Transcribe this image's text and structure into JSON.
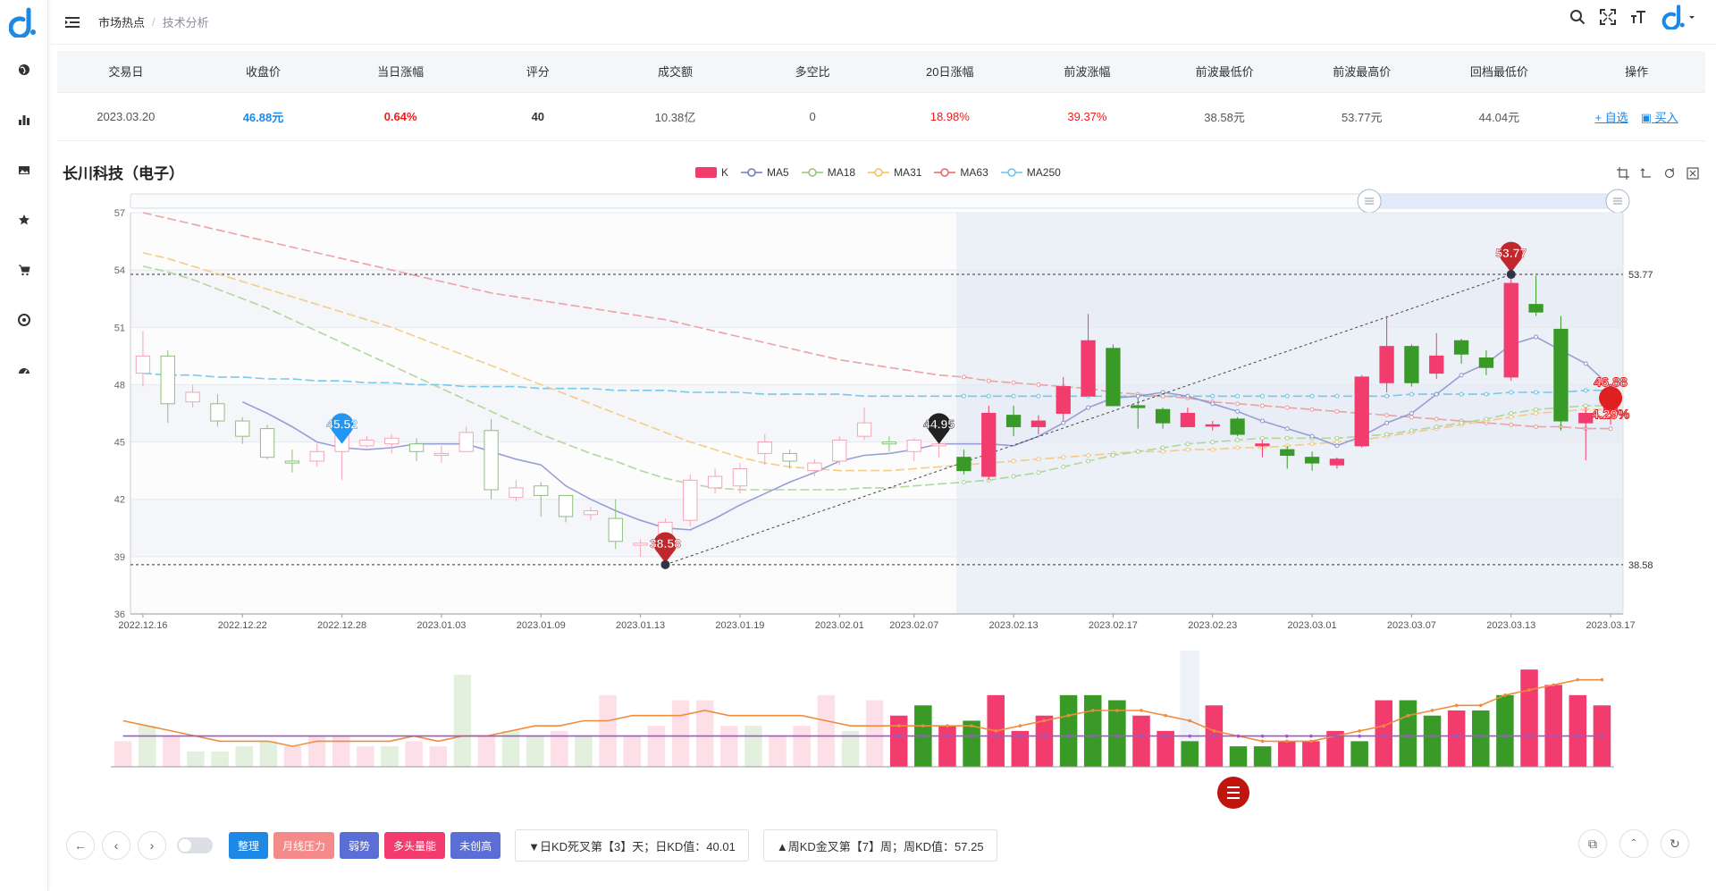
{
  "header": {
    "breadcrumb": [
      "市场热点",
      "技术分析"
    ],
    "logo": "d-logo",
    "tools": [
      "search-icon",
      "fullscreen-icon",
      "font-size-icon",
      "user-logo"
    ]
  },
  "sidebar": {
    "items": [
      {
        "icon": "globe-icon"
      },
      {
        "icon": "bar-chart-icon"
      },
      {
        "icon": "image-icon"
      },
      {
        "icon": "star-icon"
      },
      {
        "icon": "cart-icon"
      },
      {
        "icon": "target-icon"
      },
      {
        "icon": "dashboard-icon"
      }
    ]
  },
  "summary": {
    "headers": [
      "交易日",
      "收盘价",
      "当日涨幅",
      "评分",
      "成交额",
      "多空比",
      "20日涨幅",
      "前波涨幅",
      "前波最低价",
      "前波最高价",
      "回档最低价",
      "操作"
    ],
    "row": {
      "date": "2023.03.20",
      "close": "46.88元",
      "change": "0.64%",
      "score": "40",
      "turnover": "10.38亿",
      "ratio": "0",
      "change20": "18.98%",
      "prev_wave": "39.37%",
      "prev_low": "38.58元",
      "prev_high": "53.77元",
      "pullback_low": "44.04元",
      "op_add": "+ 自选",
      "op_buy": "买入"
    }
  },
  "stock_title": "长川科技（电子）",
  "legend": [
    {
      "name": "K",
      "color": "#f23c6e"
    },
    {
      "name": "MA5",
      "color": "#6f7bb8"
    },
    {
      "name": "MA18",
      "color": "#93c47d"
    },
    {
      "name": "MA31",
      "color": "#f3c25b"
    },
    {
      "name": "MA63",
      "color": "#e06666"
    },
    {
      "name": "MA250",
      "color": "#6bc3e6"
    }
  ],
  "chart_data": {
    "type": "candlestick",
    "y_ticks": [
      36,
      39,
      42,
      45,
      48,
      51,
      54,
      57
    ],
    "ylim": [
      36,
      57
    ],
    "x_tick_labels": [
      "2022.12.16",
      "2022.12.22",
      "2022.12.28",
      "2023.01.03",
      "2023.01.09",
      "2023.01.13",
      "2023.01.19",
      "2023.02.01",
      "2023.02.07",
      "2023.02.13",
      "2023.02.17",
      "2023.02.23",
      "2023.03.01",
      "2023.03.07",
      "2023.03.13",
      "2023.03.17"
    ],
    "ohlc": [
      [
        48.6,
        49.5,
        50.8,
        47.9
      ],
      [
        49.5,
        47.0,
        49.8,
        46.0
      ],
      [
        47.1,
        47.6,
        48.0,
        46.8
      ],
      [
        47.0,
        46.1,
        47.5,
        45.8
      ],
      [
        46.1,
        45.3,
        46.3,
        44.9
      ],
      [
        45.7,
        44.2,
        45.9,
        44.1
      ],
      [
        44.0,
        43.9,
        44.6,
        43.4
      ],
      [
        44.0,
        44.5,
        44.9,
        43.7
      ],
      [
        44.5,
        45.5,
        45.6,
        43.0
      ],
      [
        44.8,
        45.1,
        45.3,
        44.7
      ],
      [
        44.9,
        45.2,
        45.4,
        44.4
      ],
      [
        44.9,
        44.5,
        45.2,
        44.0
      ],
      [
        44.3,
        44.4,
        44.8,
        43.9
      ],
      [
        44.5,
        45.5,
        45.8,
        44.5
      ],
      [
        45.6,
        42.5,
        46.2,
        42.0
      ],
      [
        42.1,
        42.6,
        43.0,
        41.9
      ],
      [
        42.7,
        42.2,
        42.9,
        41.1
      ],
      [
        42.2,
        41.1,
        42.2,
        40.8
      ],
      [
        41.2,
        41.4,
        41.6,
        40.9
      ],
      [
        41.0,
        39.8,
        42.0,
        39.4
      ],
      [
        39.6,
        39.7,
        39.9,
        39.0
      ],
      [
        39.2,
        40.8,
        41.0,
        38.58
      ],
      [
        40.9,
        43.0,
        43.3,
        40.6
      ],
      [
        42.6,
        43.2,
        43.6,
        42.3
      ],
      [
        42.7,
        43.6,
        43.9,
        42.3
      ],
      [
        44.4,
        45.0,
        45.4,
        43.8
      ],
      [
        44.4,
        44.0,
        44.6,
        43.6
      ],
      [
        43.5,
        43.9,
        44.1,
        43.2
      ],
      [
        44.0,
        45.1,
        45.3,
        43.8
      ],
      [
        45.3,
        46.0,
        46.8,
        45.1
      ],
      [
        45.0,
        44.9,
        45.3,
        44.5
      ],
      [
        44.5,
        45.1,
        45.2,
        44.0
      ],
      [
        44.8,
        44.9,
        45.1,
        44.2
      ],
      [
        44.2,
        43.5,
        44.6,
        43.3
      ],
      [
        43.2,
        46.5,
        46.9,
        43.0
      ],
      [
        46.4,
        45.8,
        46.9,
        45.3
      ],
      [
        45.8,
        46.1,
        46.4,
        45.4
      ],
      [
        46.5,
        47.9,
        48.4,
        46.1
      ],
      [
        47.4,
        50.3,
        51.7,
        47.4
      ],
      [
        49.9,
        46.9,
        50.1,
        46.9
      ],
      [
        46.9,
        46.8,
        47.3,
        45.7
      ],
      [
        46.7,
        46.0,
        46.8,
        45.7
      ],
      [
        45.8,
        46.5,
        46.8,
        45.9
      ],
      [
        45.9,
        45.9,
        46.1,
        45.6
      ],
      [
        46.2,
        45.4,
        46.3,
        45.3
      ],
      [
        44.8,
        44.9,
        45.1,
        44.2
      ],
      [
        44.6,
        44.3,
        44.8,
        43.6
      ],
      [
        44.2,
        43.9,
        44.5,
        43.5
      ],
      [
        43.8,
        44.1,
        44.2,
        43.6
      ],
      [
        44.8,
        48.4,
        48.5,
        44.7
      ],
      [
        48.1,
        50.0,
        51.6,
        47.6
      ],
      [
        50.0,
        48.1,
        50.1,
        47.9
      ],
      [
        48.6,
        49.5,
        50.7,
        48.3
      ],
      [
        50.3,
        49.6,
        50.4,
        49.1
      ],
      [
        49.4,
        48.9,
        49.8,
        48.5
      ],
      [
        48.4,
        53.3,
        53.77,
        48.2
      ],
      [
        52.2,
        51.8,
        53.7,
        51.6
      ],
      [
        50.9,
        46.1,
        51.6,
        45.6
      ],
      [
        46.0,
        46.5,
        46.8,
        44.04
      ],
      [
        46.6,
        46.88,
        47.1,
        45.9
      ]
    ],
    "ma5": [
      null,
      null,
      null,
      null,
      47.1,
      46.5,
      45.8,
      45.0,
      44.7,
      44.6,
      44.7,
      44.9,
      44.9,
      44.9,
      44.5,
      44.1,
      43.8,
      42.7,
      42.0,
      41.4,
      40.9,
      40.5,
      40.4,
      41.0,
      41.7,
      42.3,
      42.9,
      43.4,
      44.0,
      44.3,
      44.4,
      44.6,
      44.9,
      44.9,
      44.9,
      44.8,
      45.3,
      46.0,
      46.8,
      47.3,
      47.4,
      47.6,
      47.4,
      47.0,
      46.6,
      46.1,
      45.7,
      45.3,
      44.8,
      45.3,
      46.0,
      46.5,
      47.5,
      48.5,
      49.1,
      50.1,
      50.5,
      49.8,
      49.1,
      47.9
    ],
    "ma18": [
      54.2,
      53.9,
      53.5,
      53.0,
      52.5,
      52.0,
      51.4,
      50.8,
      50.2,
      49.6,
      49.0,
      48.4,
      47.8,
      47.2,
      46.6,
      46.0,
      45.4,
      44.9,
      44.4,
      44.0,
      43.5,
      43.1,
      42.8,
      42.6,
      42.5,
      42.5,
      42.5,
      42.5,
      42.5,
      42.6,
      42.6,
      42.7,
      42.8,
      42.9,
      43.0,
      43.2,
      43.4,
      43.7,
      44.0,
      44.3,
      44.5,
      44.7,
      44.9,
      45.0,
      45.1,
      45.2,
      45.2,
      45.2,
      45.2,
      45.3,
      45.4,
      45.6,
      45.8,
      46.0,
      46.2,
      46.5,
      46.7,
      46.8,
      46.9,
      46.9
    ],
    "ma31": [
      54.9,
      54.6,
      54.2,
      53.8,
      53.4,
      53.0,
      52.6,
      52.2,
      51.8,
      51.4,
      51.0,
      50.5,
      50.0,
      49.5,
      49.0,
      48.5,
      48.0,
      47.5,
      47.0,
      46.5,
      46.0,
      45.5,
      45.0,
      44.6,
      44.2,
      43.9,
      43.7,
      43.6,
      43.5,
      43.5,
      43.5,
      43.6,
      43.7,
      43.8,
      43.9,
      44.0,
      44.1,
      44.2,
      44.3,
      44.4,
      44.5,
      44.5,
      44.6,
      44.6,
      44.7,
      44.7,
      44.8,
      44.9,
      45.0,
      45.1,
      45.3,
      45.5,
      45.7,
      45.9,
      46.1,
      46.3,
      46.5,
      46.6,
      46.7,
      46.7
    ],
    "ma63": [
      57.0,
      56.7,
      56.4,
      56.1,
      55.8,
      55.5,
      55.2,
      54.9,
      54.6,
      54.3,
      54.0,
      53.7,
      53.4,
      53.1,
      52.8,
      52.6,
      52.4,
      52.2,
      52.0,
      51.8,
      51.6,
      51.4,
      51.1,
      50.8,
      50.5,
      50.2,
      49.9,
      49.6,
      49.3,
      49.1,
      48.9,
      48.7,
      48.5,
      48.4,
      48.2,
      48.1,
      48.0,
      47.9,
      47.8,
      47.6,
      47.5,
      47.4,
      47.3,
      47.1,
      47.0,
      46.9,
      46.8,
      46.7,
      46.6,
      46.5,
      46.4,
      46.3,
      46.2,
      46.1,
      46.0,
      45.9,
      45.8,
      45.8,
      45.7,
      45.7
    ],
    "ma250": [
      48.6,
      48.5,
      48.5,
      48.4,
      48.4,
      48.3,
      48.3,
      48.2,
      48.2,
      48.1,
      48.1,
      48.0,
      48.0,
      47.9,
      47.9,
      47.9,
      47.8,
      47.8,
      47.8,
      47.7,
      47.7,
      47.7,
      47.6,
      47.6,
      47.6,
      47.5,
      47.5,
      47.5,
      47.5,
      47.4,
      47.4,
      47.4,
      47.4,
      47.4,
      47.4,
      47.4,
      47.4,
      47.4,
      47.4,
      47.4,
      47.4,
      47.4,
      47.4,
      47.4,
      47.4,
      47.4,
      47.4,
      47.4,
      47.4,
      47.4,
      47.4,
      47.5,
      47.5,
      47.5,
      47.5,
      47.6,
      47.6,
      47.6,
      47.7,
      47.7
    ],
    "volume": [
      5,
      8,
      6,
      3,
      3,
      4,
      5,
      4,
      6,
      6,
      4,
      4,
      5,
      4,
      18,
      6,
      7,
      6,
      7,
      6,
      14,
      6,
      8,
      13,
      13,
      8,
      8,
      6,
      8,
      14,
      7,
      13,
      10,
      12,
      8,
      9,
      14,
      7,
      10,
      14,
      14,
      13,
      10,
      7,
      5,
      12,
      4,
      4,
      5,
      5,
      7,
      5,
      13,
      13,
      10,
      11,
      11,
      14,
      19,
      16,
      14,
      12
    ],
    "vol_ma1": [
      9,
      8,
      7,
      6,
      5,
      5,
      5,
      4,
      5,
      5,
      5,
      5,
      6,
      5,
      6,
      6,
      7,
      8,
      8,
      9,
      9,
      10,
      10,
      10,
      11,
      10,
      10,
      10,
      10,
      9,
      8,
      8,
      8,
      8,
      8,
      8,
      7,
      8,
      9,
      10,
      11,
      11,
      11,
      10,
      9,
      7,
      6,
      5,
      5,
      5,
      6,
      7,
      8,
      10,
      11,
      12,
      12,
      14,
      15,
      16,
      17,
      17
    ],
    "vol_ma2": [
      6,
      6,
      6,
      6,
      6,
      6,
      6,
      6,
      6,
      6,
      6,
      6,
      6,
      6,
      6,
      6,
      6,
      6,
      6,
      6,
      6,
      6,
      6,
      6,
      6,
      6,
      6,
      6,
      6,
      6,
      6,
      6,
      6,
      6,
      6,
      6,
      6,
      6,
      6,
      6,
      6,
      6,
      6,
      6,
      6,
      6,
      6,
      6,
      6,
      6,
      6,
      6,
      6,
      6,
      6,
      6,
      6,
      6,
      6,
      6,
      6,
      6
    ],
    "markers": {
      "high": "53.77",
      "low": "38.58",
      "mid1": "45.52",
      "mid2": "44.95",
      "last": "46.88",
      "last_pct": "4.29%"
    },
    "ref_lines": {
      "high": "53.77",
      "low": "38.58"
    }
  },
  "toolbar": {
    "tags": [
      {
        "label": "整理",
        "color": "#1e88e5"
      },
      {
        "label": "月线压力",
        "color": "#f48a8a"
      },
      {
        "label": "弱势",
        "color": "#5b6ed6"
      },
      {
        "label": "多头量能",
        "color": "#f23c6e"
      },
      {
        "label": "未创高",
        "color": "#5b6ed6"
      }
    ],
    "kd_day": "▼日KD死叉第【3】天；日KD值：40.01",
    "kd_week": "▲周KD金叉第【7】周；周KD值：57.25"
  }
}
